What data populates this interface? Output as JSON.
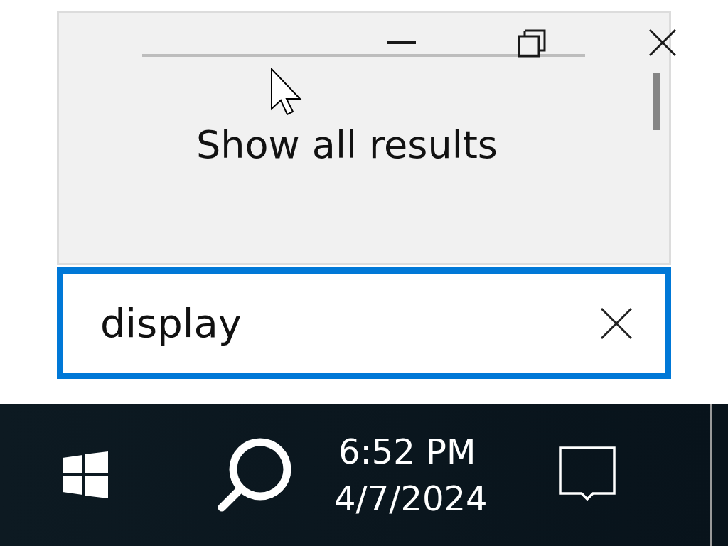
{
  "results_panel": {
    "link": "Show all results"
  },
  "search": {
    "value": "display"
  },
  "taskbar": {
    "time": "6:52 PM",
    "date": "4/7/2024"
  }
}
